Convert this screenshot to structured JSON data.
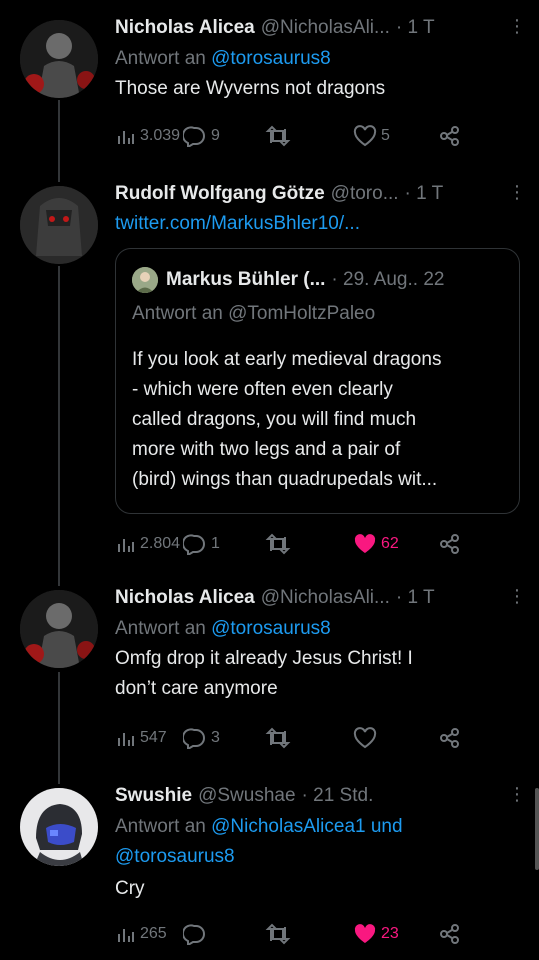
{
  "tweets": [
    {
      "name": "Nicholas Alicea",
      "handle": "@NicholasAli...",
      "time": "· 1 T",
      "reply_prefix": "Antwort an",
      "reply_to": "@torosaurus8",
      "text": "Those are Wyverns not dragons",
      "views": "3.039",
      "replies": "9",
      "retweets": "",
      "likes": "5"
    },
    {
      "name": "Rudolf Wolfgang Götze",
      "handle": "@toro...",
      "time": "· 1 T",
      "link": "twitter.com/MarkusBhler10/...",
      "quote": {
        "name": "Markus Bühler (...",
        "time": "· 29. Aug.. 22",
        "reply": "Antwort an @TomHoltzPaleo",
        "lines": [
          "If you look at early medieval dragons",
          "- which were often even clearly",
          "called dragons, you will find much",
          "more with two legs and a pair of",
          "(bird) wings than quadrupedals wit..."
        ]
      },
      "views": "2.804",
      "replies": "1",
      "retweets": "",
      "likes": "62"
    },
    {
      "name": "Nicholas Alicea",
      "handle": "@NicholasAli...",
      "time": "· 1 T",
      "reply_prefix": "Antwort an",
      "reply_to": "@torosaurus8",
      "text_lines": [
        "Omfg drop it already Jesus Christ! I",
        "don’t care anymore"
      ],
      "views": "547",
      "replies": "3",
      "retweets": "",
      "likes": ""
    },
    {
      "name": "Swushie",
      "handle": "@Swushae",
      "time": "· 21 Std.",
      "reply_prefix": "Antwort an",
      "reply_to": "@NicholasAlicea1 und",
      "reply_to_2": "@torosaurus8",
      "text": "Cry",
      "views": "265",
      "replies": "",
      "retweets": "",
      "likes": "23"
    }
  ],
  "more_glyph": "⋮",
  "colors": {
    "accent": "#1d9bf0",
    "like": "#f91880",
    "muted": "#71767b"
  }
}
